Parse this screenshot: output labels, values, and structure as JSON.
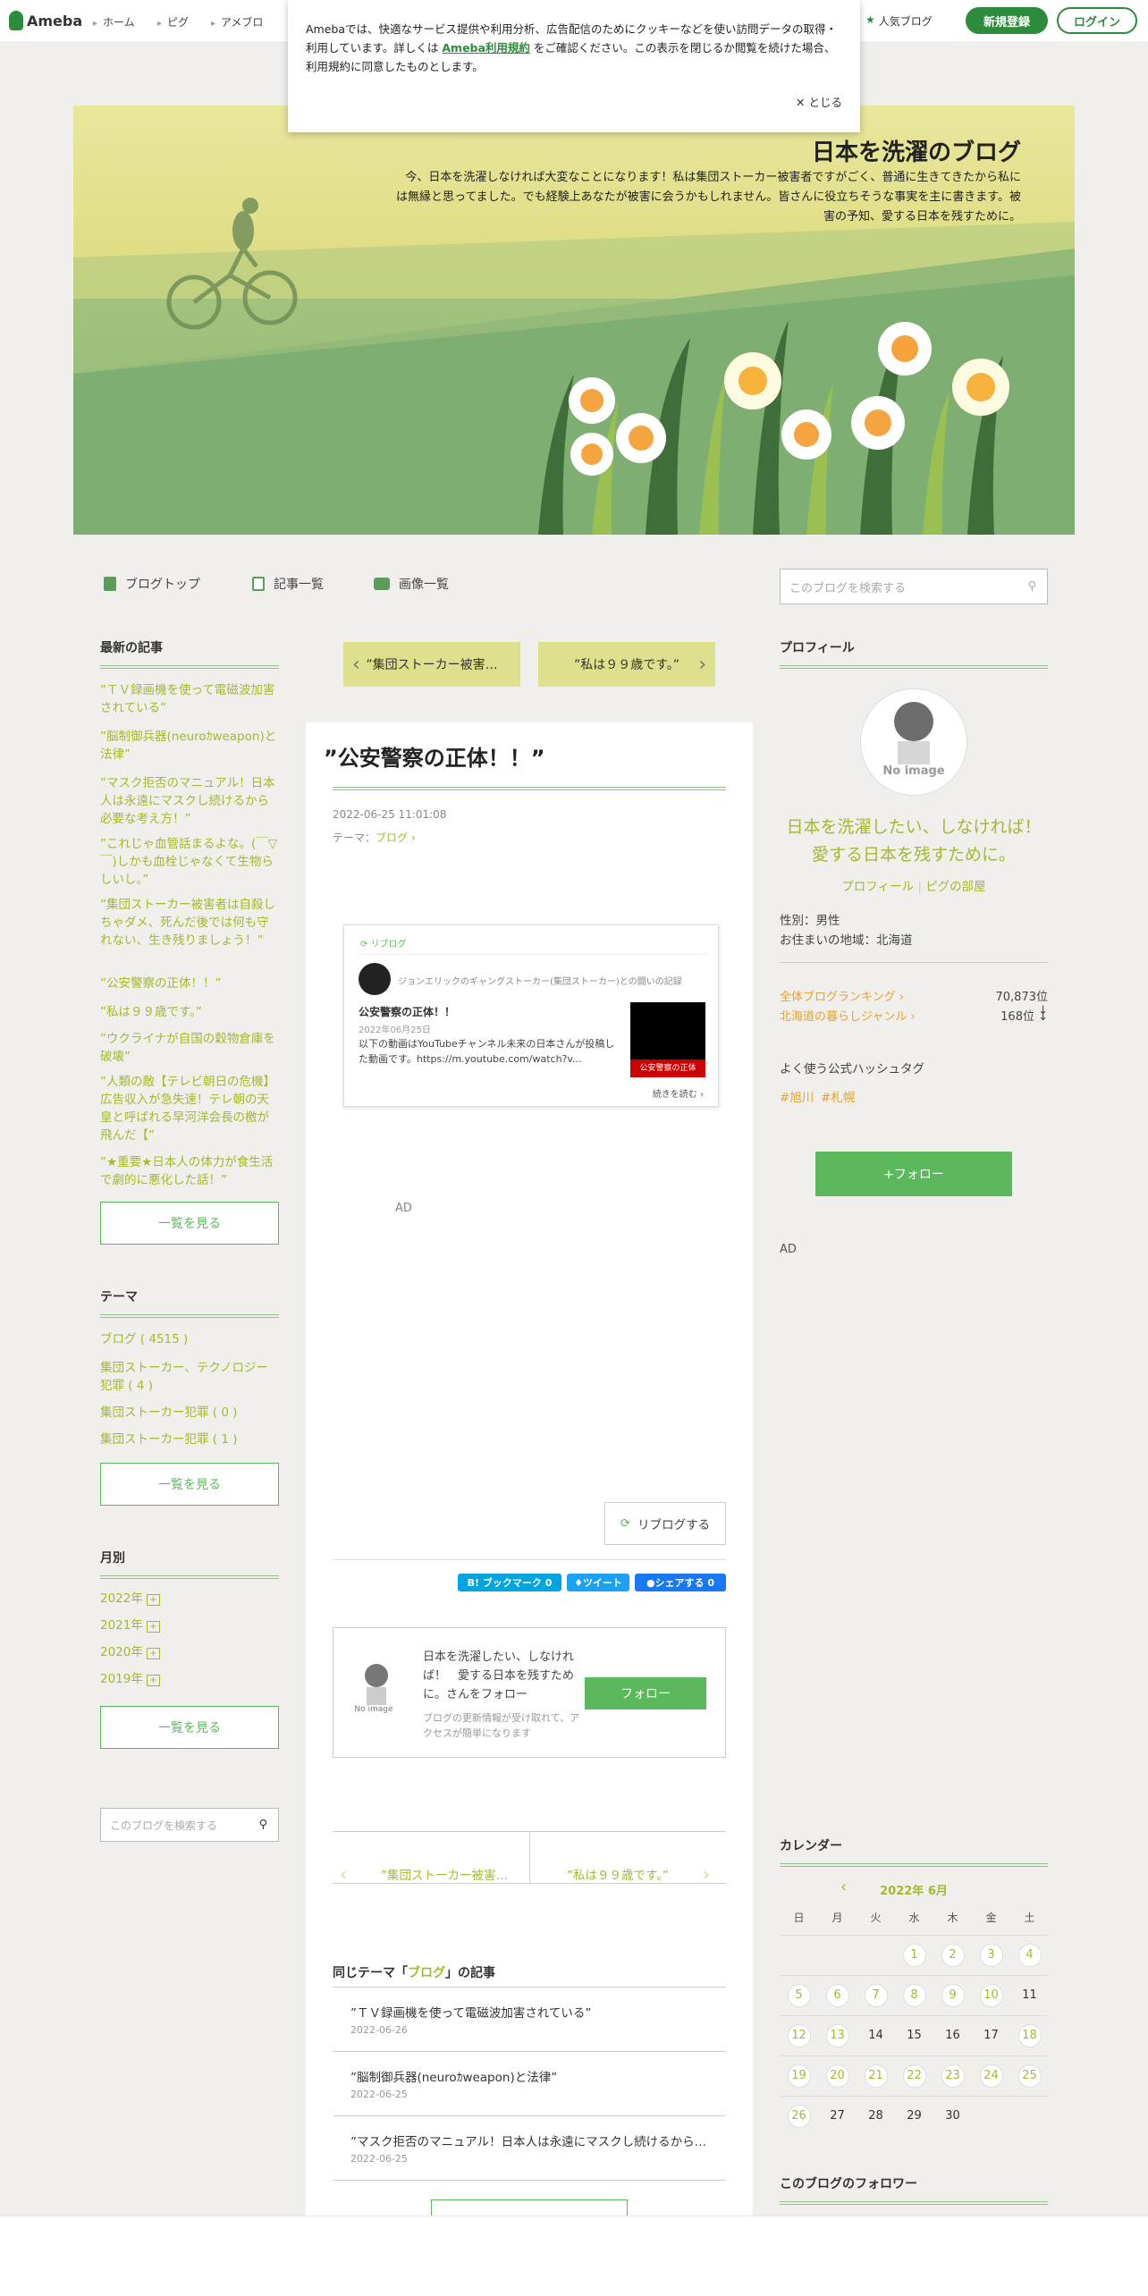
{
  "header": {
    "logo": "Ameba",
    "nav": [
      "ホーム",
      "ピグ",
      "アメブロ"
    ],
    "popular": "人気ブログ",
    "signup": "新規登録",
    "login": "ログイン"
  },
  "cookie": {
    "text_before": "Amebaでは、快適なサービス提供や利用分析、広告配信のためにクッキーなどを使い訪問データの取得・利用しています。詳しくは",
    "link": "Ameba利用規約",
    "text_after": "をご確認ください。この表示を閉じるか閲覧を続けた場合、利用規約に同意したものとします。",
    "close": "とじる"
  },
  "hero": {
    "title": "日本を洗濯のブログ",
    "description": "今、日本を洗濯しなければ大変なことになります！私は集団ストーカー被害者ですがごく、普通に生きてきたから私には無縁と思ってました。でも経験上あなたが被害に会うかもしれません。皆さんに役立ちそうな事実を主に書きます。被害の予知、愛する日本を残すために。"
  },
  "subnav": {
    "top": "ブログトップ",
    "list": "記事一覧",
    "images": "画像一覧"
  },
  "search": {
    "placeholder": "このブログを検索する"
  },
  "sidebar_left": {
    "recent_title": "最新の記事",
    "recent": [
      "”ＴＶ録画機を使って電磁波加害されている”",
      "”脳制御兵器(neuroｶweapon)と法律”",
      "”マスク拒否のマニュアル！日本人は永遠にマスクし続けるから必要な考え方！”",
      "”これじゃ血管話まるよな。(￣▽￣)しかも血栓じゃなくて生物らしいし。”",
      "”集団ストーカー被害者は自殺しちゃダメ、死んだ後では何も守れない、生き残りましょう！”",
      "”公安警察の正体！！”",
      "”私は９９歳です。”",
      "”ウクライナが自国の穀物倉庫を破壊”",
      "”人類の敵【テレビ朝日の危機】広告収入が急失速！テレ朝の天皇と呼ばれる早河洋会長の檄が飛んだ【”",
      "”★重要★日本人の体力が食生活で劇的に悪化した話！”"
    ],
    "see_all": "一覧を見る",
    "theme_title": "テーマ",
    "themes": [
      "ブログ ( 4515 )",
      "集団ストーカー、テクノロジー犯罪 ( 4 )",
      "集団ストーカー犯罪 ( 0 )",
      "集団ストーカー犯罪 ( 1 )"
    ],
    "month_title": "月別",
    "months": [
      "2022年",
      "2021年",
      "2020年",
      "2019年"
    ]
  },
  "pager": {
    "prev": "”集団ストーカー被害…",
    "next": "”私は９９歳です。”"
  },
  "article": {
    "title": "”公安警察の正体！！”",
    "date": "2022-06-25 11:01:08",
    "theme_label": "テーマ：",
    "theme": "ブログ",
    "reblog_label": "リブログ",
    "reblog_author": "ジョンエリックのギャングストーカー(集団ストーカー)との闘いの記録",
    "reblog_title": "公安警察の正体！！",
    "reblog_date": "2022年06月25日",
    "reblog_excerpt": "以下の動画はYouTubeチャンネル未来の日本さんが投稿した動画です。https://m.youtube.com/watch?v...",
    "reblog_thumb": "公安警察の正体",
    "read_more": "続きを読む",
    "ad": "AD",
    "reblog_btn": "リブログする",
    "share_hatena": "B! ブックマーク 0",
    "share_tweet": "ツイート",
    "share_fb": "シェアする 0"
  },
  "follow_box": {
    "text": "日本を洗濯したい、しなければ！　愛する日本を残すために。さんをフォロー",
    "sub": "ブログの更新情報が受け取れて、アクセスが簡単になります",
    "button": "フォロー",
    "noimage": "No image"
  },
  "related": {
    "title_before": "同じテーマ「",
    "theme": "ブログ",
    "title_after": "」の記事",
    "items": [
      {
        "title": "”ＴＶ録画機を使って電磁波加害されている”",
        "date": "2022-06-26"
      },
      {
        "title": "”脳制御兵器(neuroｶweapon)と法律”",
        "date": "2022-06-25"
      },
      {
        "title": "”マスク拒否のマニュアル！日本人は永遠にマスクし続けるから…",
        "date": "2022-06-25"
      }
    ]
  },
  "profile": {
    "title": "プロフィール",
    "noimage": "No image",
    "name": "日本を洗濯したい、しなければ！ 愛する日本を残すために。",
    "link_profile": "プロフィール",
    "link_pigg": "ピグの部屋",
    "gender": "性別：男性",
    "location": "お住まいの地域：北海道",
    "rank_all": "全体ブログランキング",
    "rank_all_val": "70,873位 ↓",
    "rank_genre": "北海道の暮らしジャンル",
    "rank_genre_val": "168位 ↓",
    "hashtag_title": "よく使う公式ハッシュタグ",
    "hashtags": [
      "#旭川",
      "#札幌"
    ],
    "follow_btn": "+フォロー",
    "ad": "AD"
  },
  "calendar": {
    "title": "カレンダー",
    "month": "2022年 6月",
    "weekdays": [
      "日",
      "月",
      "火",
      "水",
      "木",
      "金",
      "土"
    ],
    "weeks": [
      [
        "",
        "",
        "",
        "1",
        "2",
        "3",
        "4"
      ],
      [
        "5",
        "6",
        "7",
        "8",
        "9",
        "10",
        "11"
      ],
      [
        "12",
        "13",
        "14",
        "15",
        "16",
        "17",
        "18"
      ],
      [
        "19",
        "20",
        "21",
        "22",
        "23",
        "24",
        "25"
      ],
      [
        "26",
        "27",
        "28",
        "29",
        "30",
        "",
        ""
      ]
    ],
    "linked_days": [
      "1",
      "2",
      "3",
      "4",
      "5",
      "6",
      "7",
      "8",
      "9",
      "10",
      "12",
      "13",
      "18",
      "19",
      "20",
      "21",
      "22",
      "23",
      "24",
      "25",
      "26"
    ]
  },
  "followers": {
    "title": "このブログのフォロワー"
  }
}
